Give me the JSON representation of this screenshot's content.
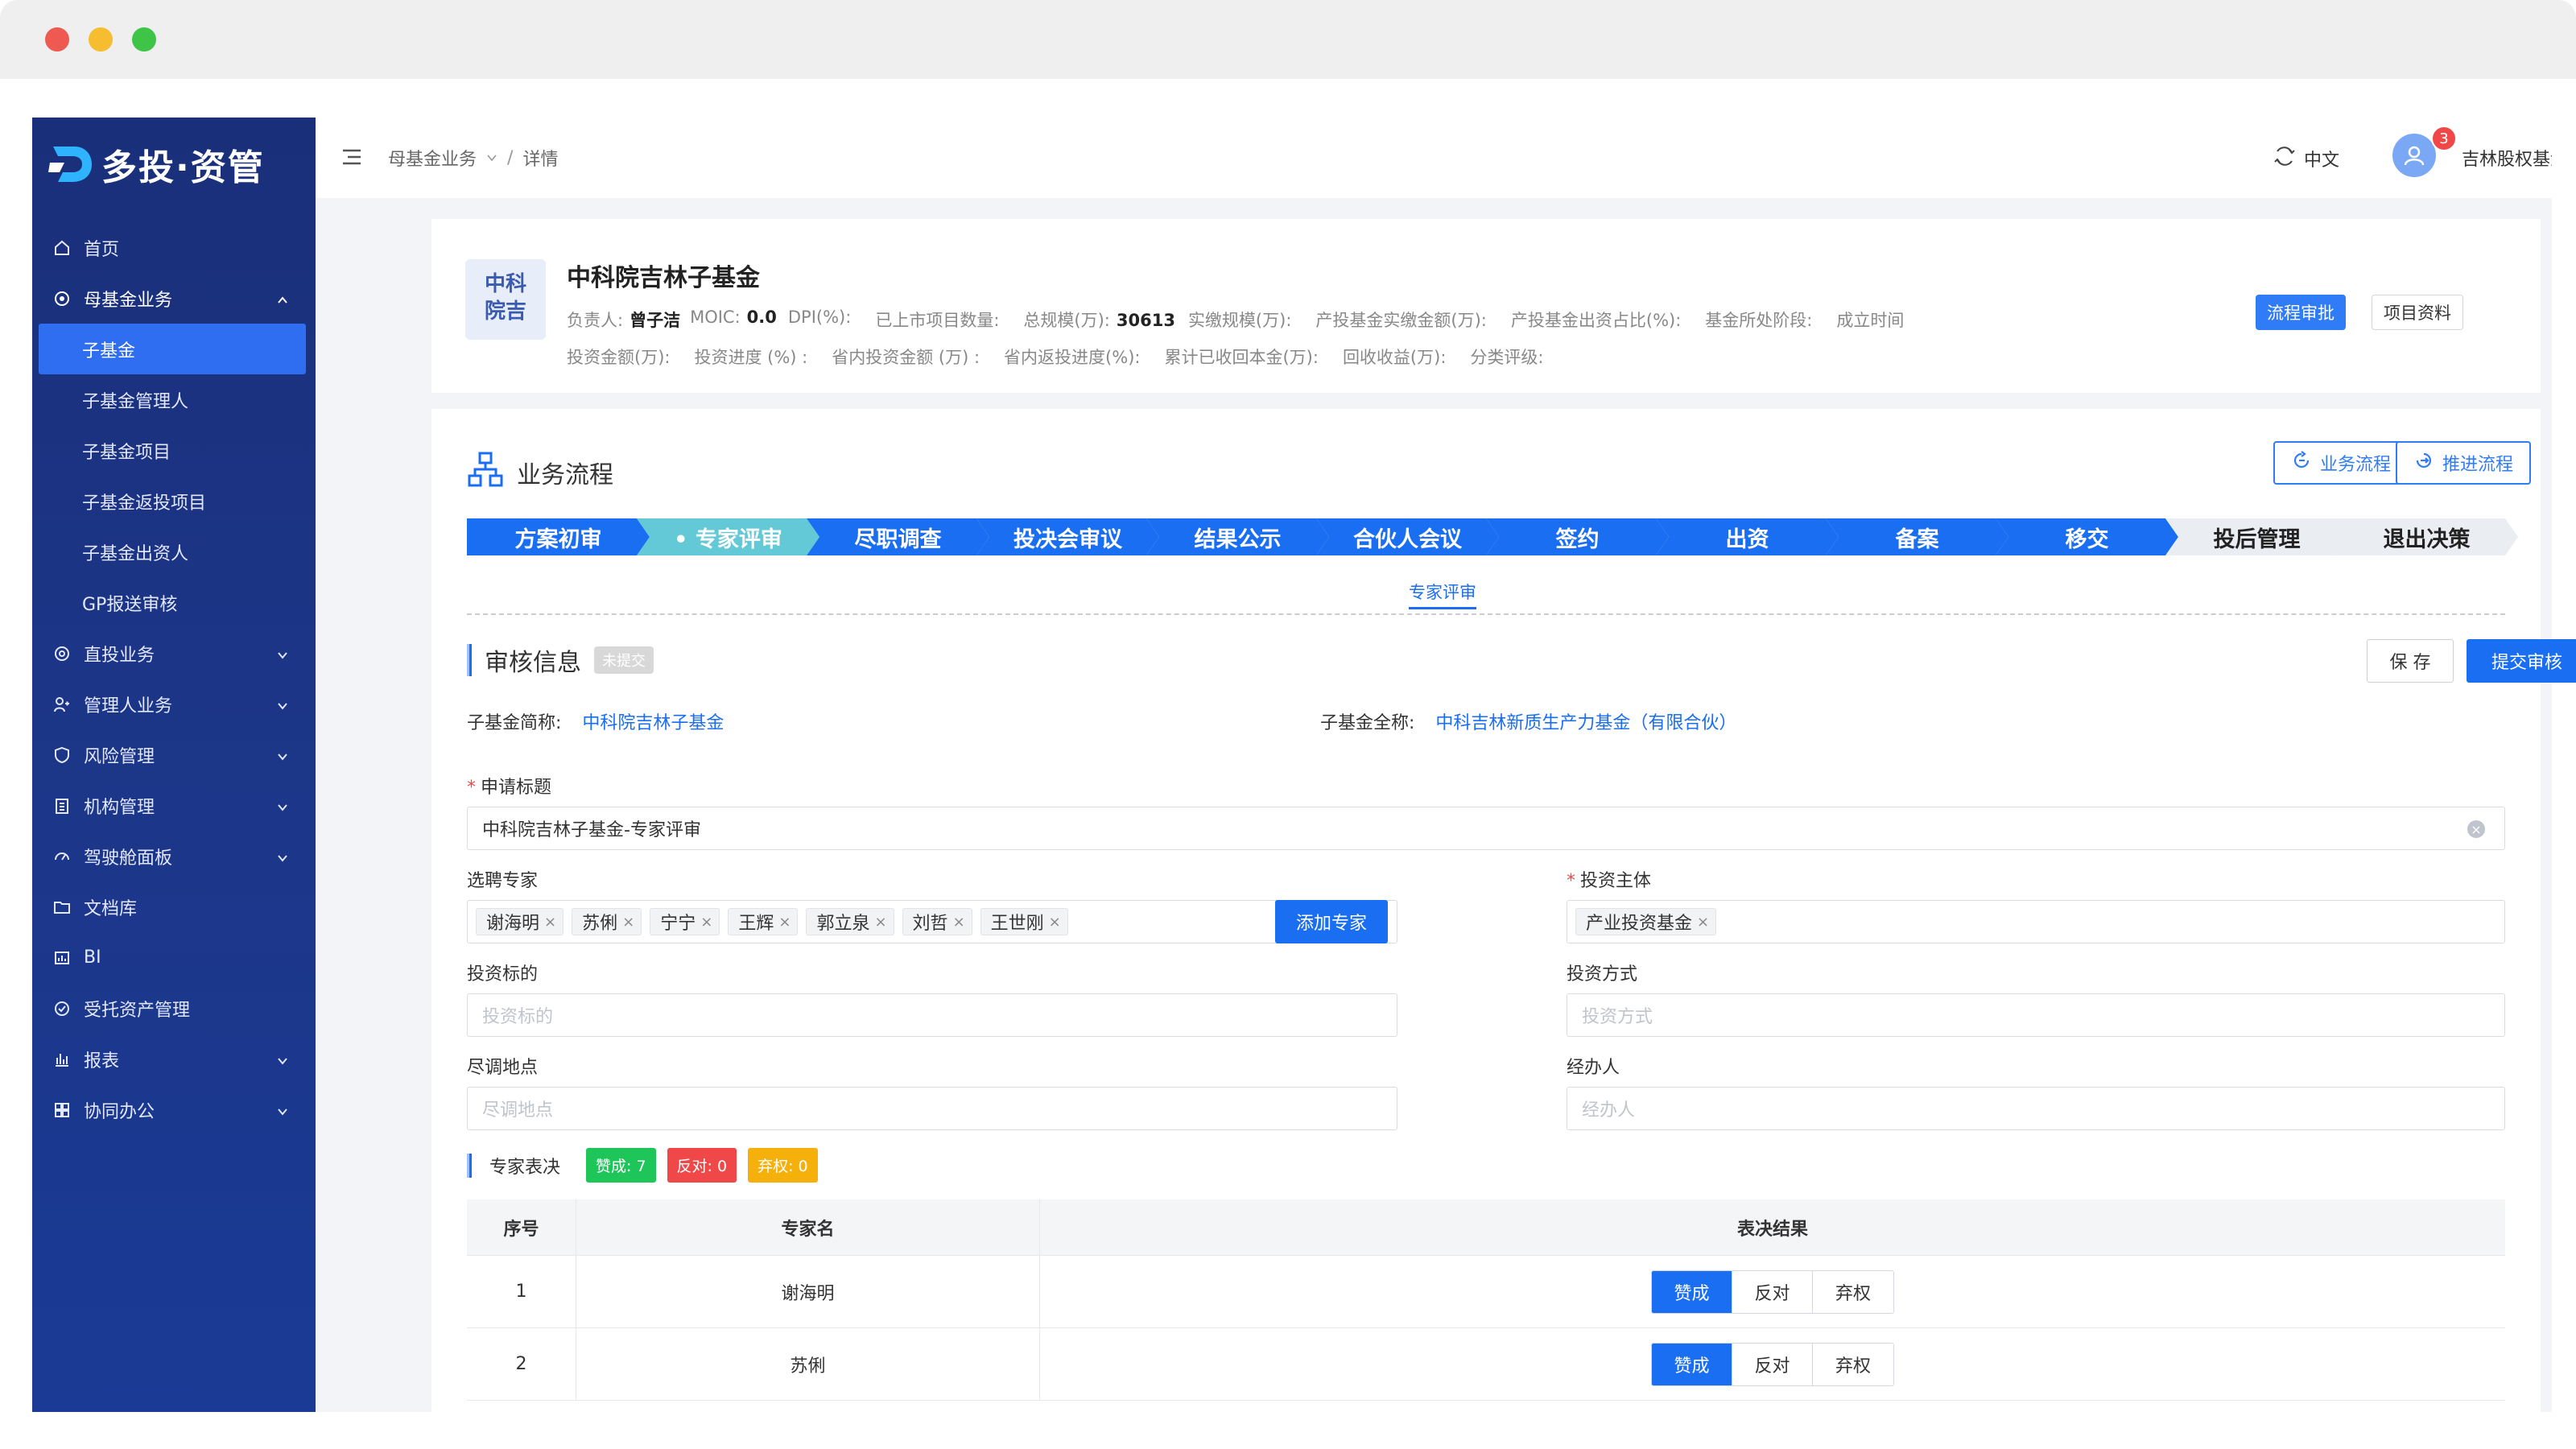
{
  "app": {
    "logo_text": "多投·资管"
  },
  "sidebar": {
    "items": [
      {
        "label": "首页",
        "icon": "home-icon"
      },
      {
        "label": "母基金业务",
        "icon": "fund-icon"
      },
      {
        "label": "子基金"
      },
      {
        "label": "子基金管理人"
      },
      {
        "label": "子基金项目"
      },
      {
        "label": "子基金返投项目"
      },
      {
        "label": "子基金出资人"
      },
      {
        "label": "GP报送审核"
      },
      {
        "label": "直投业务",
        "icon": "target-icon"
      },
      {
        "label": "管理人业务",
        "icon": "manager-icon"
      },
      {
        "label": "风险管理",
        "icon": "shield-icon"
      },
      {
        "label": "机构管理",
        "icon": "building-icon"
      },
      {
        "label": "驾驶舱面板",
        "icon": "dashboard-icon"
      },
      {
        "label": "文档库",
        "icon": "folder-icon"
      },
      {
        "label": "BI",
        "icon": "bi-icon"
      },
      {
        "label": "受托资产管理",
        "icon": "asset-icon"
      },
      {
        "label": "报表",
        "icon": "report-icon"
      },
      {
        "label": "协同办公",
        "icon": "office-icon"
      }
    ]
  },
  "header": {
    "breadcrumb_1": "母基金业务",
    "breadcrumb_2": "详情",
    "lang": "中文",
    "notification_count": "3",
    "user_name": "吉林股权基金"
  },
  "fund": {
    "logo_line1": "中科",
    "logo_line2": "院吉",
    "title": "中科院吉林子基金",
    "row1": {
      "owner_label": "负责人:",
      "owner_value": "曾子洁",
      "moic_label": "MOIC:",
      "moic_value": "0.0",
      "dpi_label": "DPI(%):",
      "listed_label": "已上市项目数量:",
      "scale_label": "总规模(万):",
      "scale_value": "30613",
      "paid_label": "实缴规模(万):",
      "industry_paid_label": "产投基金实缴金额(万):",
      "industry_ratio_label": "产投基金出资占比(%):",
      "stage_label": "基金所处阶段:",
      "established_label": "成立时间"
    },
    "row2": {
      "invest_amount_label": "投资金额(万):",
      "invest_progress_label": "投资进度 (%) :",
      "province_amount_label": "省内投资金额 (万) :",
      "province_progress_label": "省内返投进度(%):",
      "recovered_label": "累计已收回本金(万):",
      "return_label": "回收收益(万):",
      "rating_label": "分类评级:"
    },
    "btn_flow_approve": "流程审批",
    "btn_project_docs": "项目资料"
  },
  "process": {
    "title": "业务流程",
    "btn_business_flow": "业务流程",
    "btn_advance_flow": "推进流程",
    "steps": [
      {
        "label": "方案初审",
        "status": "done"
      },
      {
        "label": "• 专家评审",
        "status": "current"
      },
      {
        "label": "尽职调查",
        "status": "done"
      },
      {
        "label": "投决会审议",
        "status": "done"
      },
      {
        "label": "结果公示",
        "status": "done"
      },
      {
        "label": "合伙人会议",
        "status": "done"
      },
      {
        "label": "签约",
        "status": "done"
      },
      {
        "label": "出资",
        "status": "done"
      },
      {
        "label": "备案",
        "status": "done"
      },
      {
        "label": "移交",
        "status": "done"
      },
      {
        "label": "投后管理",
        "status": "todo"
      },
      {
        "label": "退出决策",
        "status": "todo"
      }
    ],
    "current_tab": "专家评审"
  },
  "review": {
    "title": "审核信息",
    "status_tag": "未提交",
    "btn_save": "保 存",
    "btn_submit": "提交审核",
    "short_name_label": "子基金简称:",
    "short_name_value": "中科院吉林子基金",
    "full_name_label": "子基金全称:",
    "full_name_value": "中科吉林新质生产力基金（有限合伙）",
    "apply_title_label": "申请标题",
    "apply_title_value": "中科院吉林子基金-专家评审",
    "experts_label": "选聘专家",
    "experts": [
      "谢海明",
      "苏俐",
      "宁宁",
      "王辉",
      "郭立泉",
      "刘哲",
      "王世刚"
    ],
    "btn_add_expert": "添加专家",
    "subject_label": "投资主体",
    "subject_chip": "产业投资基金",
    "target_label": "投资标的",
    "target_placeholder": "投资标的",
    "method_label": "投资方式",
    "method_placeholder": "投资方式",
    "location_label": "尽调地点",
    "location_placeholder": "尽调地点",
    "handler_label": "经办人",
    "handler_placeholder": "经办人"
  },
  "vote": {
    "label": "专家表决",
    "approve": "赞成: 7",
    "oppose": "反对: 0",
    "abstain": "弃权: 0"
  },
  "table": {
    "headers": [
      "序号",
      "专家名",
      "表决结果"
    ],
    "options": [
      "赞成",
      "反对",
      "弃权"
    ],
    "rows": [
      {
        "no": "1",
        "name": "谢海明",
        "result": "赞成"
      },
      {
        "no": "2",
        "name": "苏俐",
        "result": "赞成"
      }
    ]
  },
  "colors": {
    "primary": "#1a6ef2",
    "sidebar": "#1c3688",
    "current_step": "#63c9d6",
    "approve": "#1ec65a",
    "oppose": "#f04848",
    "abstain": "#f6b00c"
  }
}
